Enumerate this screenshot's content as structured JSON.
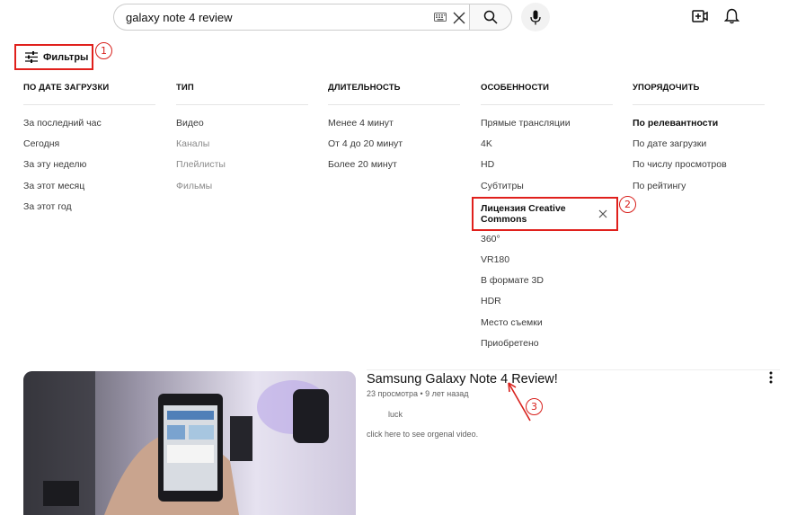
{
  "search": {
    "query": "galaxy note 4 review"
  },
  "filters_button": {
    "label": "Фильтры"
  },
  "callouts": [
    "1",
    "2",
    "3"
  ],
  "filter_columns": [
    {
      "heading": "ПО ДАТЕ ЗАГРУЗКИ",
      "options": [
        {
          "label": "За последний час",
          "state": "normal"
        },
        {
          "label": "Сегодня",
          "state": "normal"
        },
        {
          "label": "За эту неделю",
          "state": "normal"
        },
        {
          "label": "За этот месяц",
          "state": "normal"
        },
        {
          "label": "За этот год",
          "state": "normal"
        }
      ]
    },
    {
      "heading": "ТИП",
      "options": [
        {
          "label": "Видео",
          "state": "normal"
        },
        {
          "label": "Каналы",
          "state": "muted"
        },
        {
          "label": "Плейлисты",
          "state": "muted"
        },
        {
          "label": "Фильмы",
          "state": "muted"
        }
      ]
    },
    {
      "heading": "ДЛИТЕЛЬНОСТЬ",
      "options": [
        {
          "label": "Менее 4 минут",
          "state": "normal"
        },
        {
          "label": "От 4 до 20 минут",
          "state": "normal"
        },
        {
          "label": "Более 20 минут",
          "state": "normal"
        }
      ]
    },
    {
      "heading": "ОСОБЕННОСТИ",
      "options": [
        {
          "label": "Прямые трансляции",
          "state": "normal"
        },
        {
          "label": "4K",
          "state": "normal"
        },
        {
          "label": "HD",
          "state": "normal"
        },
        {
          "label": "Субтитры",
          "state": "normal"
        },
        {
          "label": "Лицензия Creative Commons",
          "state": "selected"
        },
        {
          "label": "360°",
          "state": "normal"
        },
        {
          "label": "VR180",
          "state": "normal"
        },
        {
          "label": "В формате 3D",
          "state": "normal"
        },
        {
          "label": "HDR",
          "state": "normal"
        },
        {
          "label": "Место съемки",
          "state": "normal"
        },
        {
          "label": "Приобретено",
          "state": "normal"
        }
      ]
    },
    {
      "heading": "УПОРЯДОЧИТЬ",
      "options": [
        {
          "label": "По релевантности",
          "state": "bold"
        },
        {
          "label": "По дате загрузки",
          "state": "normal"
        },
        {
          "label": "По числу просмотров",
          "state": "normal"
        },
        {
          "label": "По рейтингу",
          "state": "normal"
        }
      ]
    }
  ],
  "video": {
    "title": "Samsung Galaxy Note 4 Review!",
    "meta": "23 просмотра • 9 лет назад",
    "line1": "luck",
    "line2": "click here to see orgenal video."
  },
  "colors": {
    "annotation": "#e0201c",
    "text": "#0f0f0f",
    "muted": "#8a8a8a"
  },
  "icons": [
    "keyboard-icon",
    "clear-icon",
    "search-icon",
    "mic-icon",
    "create-icon",
    "bell-icon",
    "filters-icon",
    "close-icon",
    "more-vert-icon"
  ]
}
